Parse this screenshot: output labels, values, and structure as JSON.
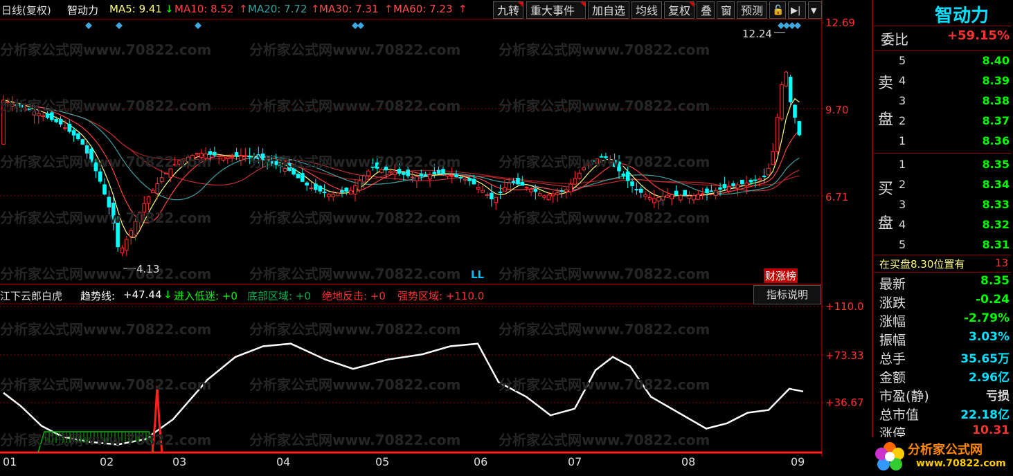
{
  "header": {
    "period": "日线(复权)",
    "stock": "智动力",
    "ma5": "MA5: 9.41",
    "ma10": "MA10: 8.52",
    "ma20": "MA20: 7.72",
    "ma30": "MA30: 7.31",
    "ma60": "MA60: 7.23",
    "arrow_down": "↓",
    "arrow_up": "↑"
  },
  "toolbar": {
    "buttons": [
      "九转",
      "重大事件",
      "加自选",
      "均线",
      "复权",
      "叠",
      "窗",
      "预测"
    ],
    "lock": "🔓",
    "next": "▶|",
    "menu": "▼"
  },
  "price_axis": {
    "top": "12.69",
    "mid": "9.70",
    "low": "6.71"
  },
  "annotations": {
    "high": "12.24",
    "low": "4.13",
    "ll": "LL",
    "badge": "财涨榜"
  },
  "indicator": {
    "name": "江下云郎白虎",
    "trend_label": "趋势线:",
    "trend_value": "+47.44",
    "enter_low": "进入低迷: +0",
    "bottom": "底部区域: +0",
    "rebound": "绝地反击: +0",
    "strong": "强势区域: +110.0",
    "help_button": "指标说明",
    "axis": [
      "+110.0",
      "+73.33",
      "+36.67"
    ]
  },
  "x_ticks": [
    "01",
    "02",
    "03",
    "04",
    "05",
    "06",
    "07",
    "08",
    "09"
  ],
  "watermark": "分析家公式网www.70822.com",
  "side": {
    "logo": "智动力",
    "weibi_label": "委比",
    "weibi_value": "+59.15%",
    "sell_label": [
      "卖",
      "盘"
    ],
    "buy_label": [
      "买",
      "盘"
    ],
    "sell": [
      {
        "n": "5",
        "p": "8.40"
      },
      {
        "n": "4",
        "p": "8.39"
      },
      {
        "n": "3",
        "p": "8.38"
      },
      {
        "n": "2",
        "p": "8.37"
      },
      {
        "n": "1",
        "p": "8.36"
      }
    ],
    "buy": [
      {
        "n": "1",
        "p": "8.35"
      },
      {
        "n": "2",
        "p": "8.34"
      },
      {
        "n": "3",
        "p": "8.33"
      },
      {
        "n": "4",
        "p": "8.32"
      },
      {
        "n": "5",
        "p": "8.31"
      }
    ],
    "notice": "在买盘8.30位置有",
    "notice_num": "13",
    "stats": [
      {
        "l": "最新",
        "v": "8.35",
        "c": "#00ff00"
      },
      {
        "l": "涨跌",
        "v": "-0.24",
        "c": "#00ff00"
      },
      {
        "l": "涨幅",
        "v": "-2.79%",
        "c": "#00ff00"
      },
      {
        "l": "振幅",
        "v": "3.03%",
        "c": "#00e0ff"
      },
      {
        "l": "总手",
        "v": "35.65万",
        "c": "#00e0ff"
      },
      {
        "l": "金额",
        "v": "2.96亿",
        "c": "#00e0ff"
      },
      {
        "l": "市盈(静)",
        "v": "亏损",
        "c": "#dddddd"
      },
      {
        "l": "总市值",
        "v": "22.18亿",
        "c": "#00e0ff"
      },
      {
        "l": "涨停",
        "v": "10.31",
        "c": "#ff3030"
      }
    ],
    "brand": "分析家公式网",
    "brand_url": "www.70822.com"
  },
  "colors": {
    "up": "#ff3030",
    "down": "#00ffff",
    "ma5": "#ffff80",
    "ma10": "#ff4040",
    "ma20": "#40a0a0",
    "ma30": "#c03030",
    "ma60": "#a02020",
    "grid": "#8b0000"
  }
}
